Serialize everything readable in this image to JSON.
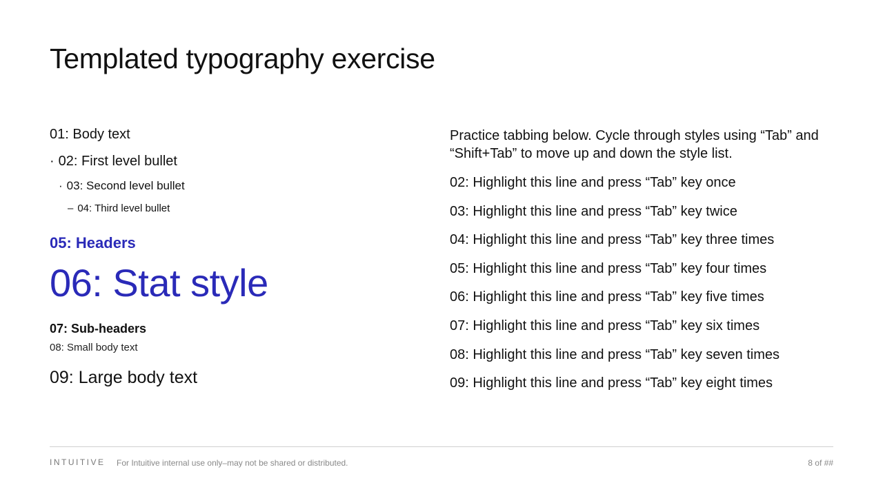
{
  "slide": {
    "title": "Templated typography exercise"
  },
  "left": {
    "body_text": "01: Body text",
    "first_bullet": "02: First level bullet",
    "second_bullet": "03: Second level bullet",
    "third_bullet": "04: Third level bullet",
    "headers": "05: Headers",
    "stat": "06: Stat style",
    "subheaders": "07: Sub-headers",
    "small_body": "08: Small body text",
    "large_body": "09: Large body text",
    "bullet_glyph_1": "·",
    "bullet_glyph_2": "·",
    "bullet_glyph_3": "–"
  },
  "right": {
    "practice": "Practice tabbing below. Cycle through styles using “Tab” and “Shift+Tab” to move up and down the style list.",
    "lines": [
      "02: Highlight this line and press “Tab” key once",
      "03: Highlight this line and press “Tab” key twice",
      "04: Highlight this line and press “Tab” key three times",
      "05: Highlight this line and press “Tab” key four times",
      "06: Highlight this line and press “Tab” key five times",
      "07: Highlight this line and press “Tab” key six times",
      "08: Highlight this line and press “Tab” key seven times",
      "09: Highlight this line and press “Tab” key eight times"
    ]
  },
  "footer": {
    "logo": "INTUITIVE",
    "disclaimer": "For Intuitive internal use only–may not be shared or distributed.",
    "page": "8 of ##"
  },
  "colors": {
    "accent": "#2a2ab8",
    "text": "#111111",
    "footer_text": "#888888"
  }
}
